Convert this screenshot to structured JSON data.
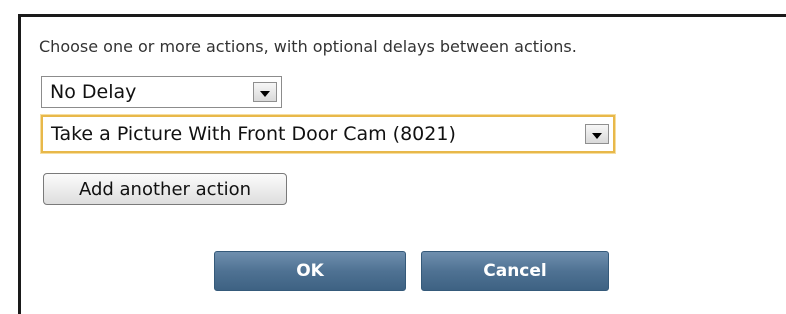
{
  "dialog": {
    "instructions": "Choose one or more actions, with optional delays between actions.",
    "delay_select": {
      "value": "No Delay"
    },
    "action_select": {
      "value": "Take a Picture With Front Door Cam (8021)"
    },
    "add_action_label": "Add another action",
    "ok_label": "OK",
    "cancel_label": "Cancel"
  },
  "colors": {
    "focus_border": "#e8b84a",
    "button_blue": "#4f7293",
    "button_text": "#ffffff"
  }
}
